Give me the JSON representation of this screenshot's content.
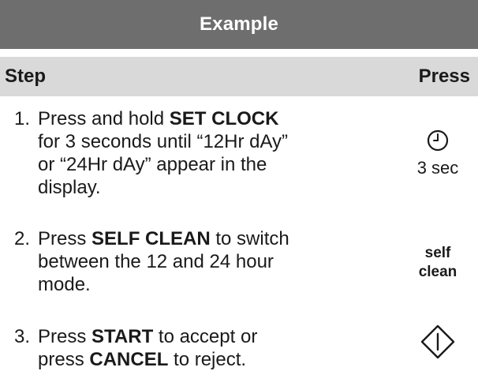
{
  "title": "Example",
  "header": {
    "step": "Step",
    "press": "Press"
  },
  "steps": [
    {
      "num": "1.",
      "pre": "Press and hold ",
      "bold": "SET CLOCK",
      "lines": [
        "for 3 seconds until “12Hr dAy”",
        "or “24Hr dAy” appear in the",
        "display."
      ],
      "press_icon": "clock-icon",
      "press_label": "3 sec"
    },
    {
      "num": "2.",
      "pre": "Press ",
      "bold": "SELF CLEAN",
      "post": " to switch",
      "lines": [
        "between the 12 and 24 hour",
        "mode."
      ],
      "press_label_line1": "self",
      "press_label_line2": "clean"
    },
    {
      "num": "3.",
      "pre": "Press ",
      "bold": "START",
      "post": " to accept or",
      "line2_pre": "press ",
      "line2_bold": "CANCEL",
      "line2_post": " to reject.",
      "press_icon": "start-diamond-icon"
    }
  ],
  "colors": {
    "title_bg": "#6e6e6e",
    "header_bg": "#d9d9d9",
    "text": "#1a1a1a"
  }
}
